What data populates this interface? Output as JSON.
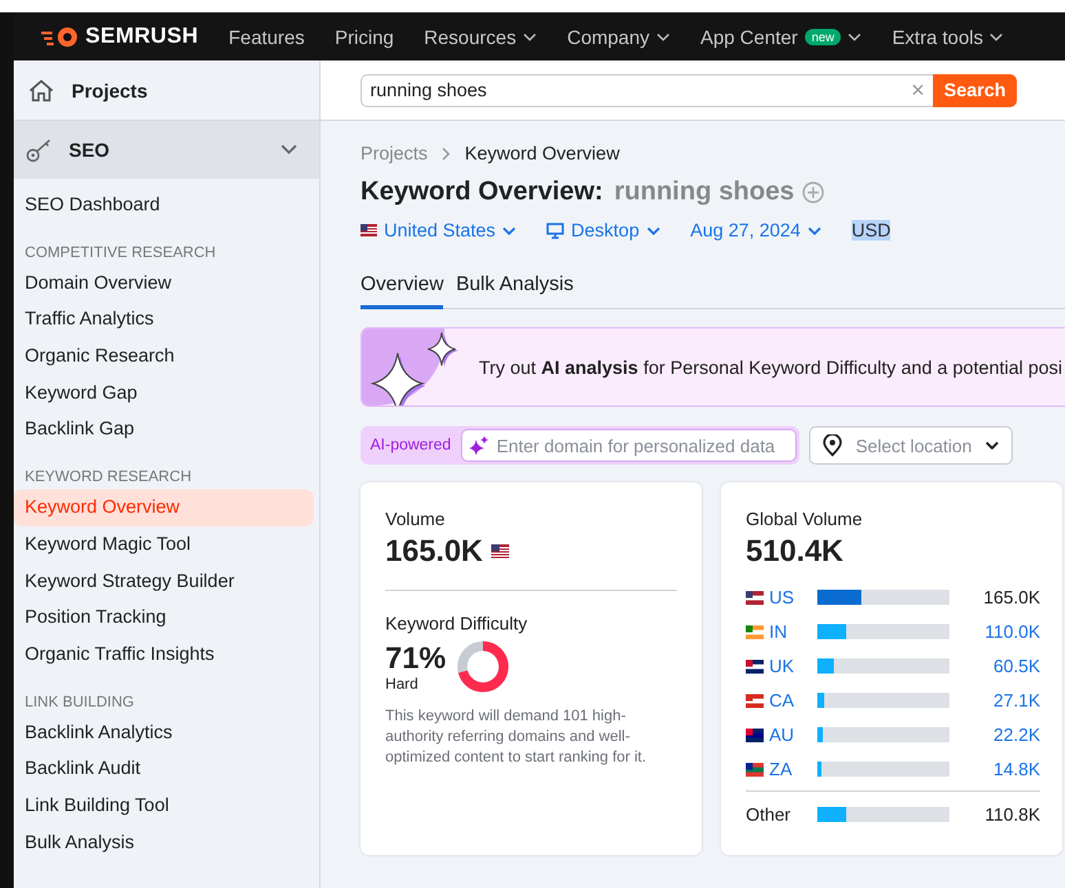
{
  "nav": {
    "logo": "SEMRUSH",
    "items": [
      {
        "label": "Features",
        "dropdown": false
      },
      {
        "label": "Pricing",
        "dropdown": false
      },
      {
        "label": "Resources",
        "dropdown": true
      },
      {
        "label": "Company",
        "dropdown": true
      },
      {
        "label": "App Center",
        "badge": "new",
        "dropdown": true
      },
      {
        "label": "Extra tools",
        "dropdown": true
      }
    ]
  },
  "sidebar": {
    "projects": "Projects",
    "section": {
      "label": "SEO",
      "expanded": true
    },
    "groups": [
      {
        "items": [
          {
            "label": "SEO Dashboard",
            "selected": false
          }
        ]
      },
      {
        "heading": "COMPETITIVE RESEARCH",
        "items": [
          {
            "label": "Domain Overview",
            "selected": false
          },
          {
            "label": "Traffic Analytics",
            "selected": false
          },
          {
            "label": "Organic Research",
            "selected": false
          },
          {
            "label": "Keyword Gap",
            "selected": false
          },
          {
            "label": "Backlink Gap",
            "selected": false
          }
        ]
      },
      {
        "heading": "KEYWORD RESEARCH",
        "items": [
          {
            "label": "Keyword Overview",
            "selected": true
          },
          {
            "label": "Keyword Magic Tool",
            "selected": false
          },
          {
            "label": "Keyword Strategy Builder",
            "selected": false
          },
          {
            "label": "Position Tracking",
            "selected": false
          },
          {
            "label": "Organic Traffic Insights",
            "selected": false
          }
        ]
      },
      {
        "heading": "LINK BUILDING",
        "items": [
          {
            "label": "Backlink Analytics",
            "selected": false
          },
          {
            "label": "Backlink Audit",
            "selected": false
          },
          {
            "label": "Link Building Tool",
            "selected": false
          },
          {
            "label": "Bulk Analysis",
            "selected": false
          }
        ]
      }
    ]
  },
  "search": {
    "value": "running shoes",
    "clear": "×",
    "button": "Search"
  },
  "breadcrumb": [
    "Projects",
    "Keyword Overview"
  ],
  "title": {
    "label": "Keyword Overview:",
    "keyword": "running shoes"
  },
  "filters": {
    "country": "United States",
    "device": "Desktop",
    "date": "Aug 27, 2024",
    "currency": "USD"
  },
  "tabs": [
    {
      "label": "Overview",
      "selected": true
    },
    {
      "label": "Bulk Analysis",
      "selected": false
    }
  ],
  "banner": {
    "text": "Try out **AI analysis** for Personal Keyword Difficulty and a potential posi"
  },
  "ai_bar": {
    "badge": "AI-powered",
    "placeholder": "Enter domain for personalized data",
    "location_placeholder": "Select location"
  },
  "volume_card": {
    "label": "Volume",
    "value": "165.0K",
    "difficulty_label": "Keyword Difficulty",
    "difficulty": "71%",
    "difficulty_text": "Hard",
    "description": "This keyword will demand 101 high-authority referring domains and well-optimized content to start ranking for it."
  },
  "global_card": {
    "label": "Global Volume",
    "value": "510.4K",
    "countries": [
      {
        "code": "US",
        "level": 0.33,
        "value": "165.0K",
        "current": true
      },
      {
        "code": "IN",
        "level": 0.22,
        "value": "110.0K",
        "current": false
      },
      {
        "code": "UK",
        "level": 0.12,
        "value": "60.5K",
        "current": false
      },
      {
        "code": "CA",
        "level": 0.05,
        "value": "27.1K",
        "current": false
      },
      {
        "code": "AU",
        "level": 0.04,
        "value": "22.2K",
        "current": false
      },
      {
        "code": "ZA",
        "level": 0.03,
        "value": "14.8K",
        "current": false
      }
    ],
    "other": {
      "label": "Other",
      "level": 0.22,
      "value": "110.8K"
    }
  }
}
